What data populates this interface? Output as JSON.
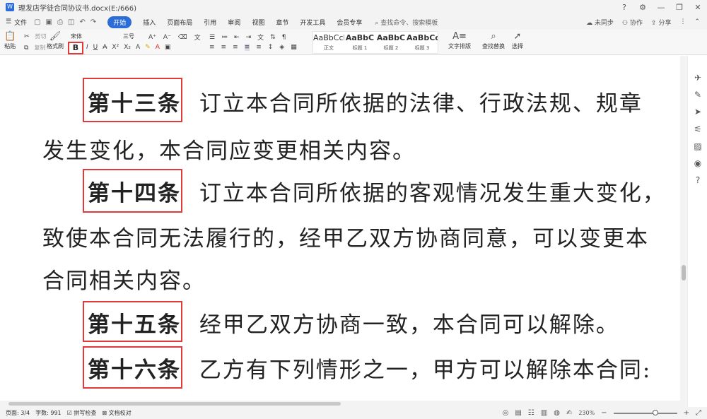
{
  "window": {
    "title": "理发店学徒合同协议书.docx(E:/666)",
    "controls": {
      "help": "?",
      "settings": "⚙",
      "minimize": "—",
      "restore": "❐",
      "close": "✕"
    }
  },
  "menubar": {
    "file_label": "文件",
    "tabs": [
      "开始",
      "插入",
      "页面布局",
      "引用",
      "审阅",
      "视图",
      "章节",
      "开发工具",
      "会员专享"
    ],
    "search_placeholder": "查找命令、搜索模板",
    "sync_label": "未同步",
    "collab_label": "协作",
    "share_label": "分享"
  },
  "ribbon": {
    "paste_label": "粘贴",
    "cut_label": "剪切",
    "copy_label": "复制",
    "format_painter_label": "格式刷",
    "font_name": "宋体",
    "font_size": "三号",
    "bold_label": "B",
    "styles": [
      {
        "sample": "AaBbCcDd",
        "name": "正文"
      },
      {
        "sample": "AaBbC",
        "name": "标题 1"
      },
      {
        "sample": "AaBbC",
        "name": "标题 2"
      },
      {
        "sample": "AaBbCc",
        "name": "标题 3"
      }
    ],
    "text_layout_label": "文字排版",
    "find_replace_label": "查找替换",
    "select_label": "选择"
  },
  "document": {
    "paragraphs": [
      {
        "article": "第十三条",
        "lines": [
          "订立本合同所依据的法律、行政法规、规章",
          "发生变化，本合同应变更相关内容。"
        ]
      },
      {
        "article": "第十四条",
        "lines": [
          "订立本合同所依据的客观情况发生重大变化，",
          "致使本合同无法履行的，经甲乙双方协商同意，可以变更本",
          "合同相关内容。"
        ]
      },
      {
        "article": "第十五条",
        "lines": [
          "经甲乙双方协商一致，本合同可以解除。"
        ]
      },
      {
        "article": "第十六条",
        "lines": [
          "乙方有下列情形之一，甲方可以解除本合同:"
        ]
      }
    ]
  },
  "statusbar": {
    "page": "页面: 3/4",
    "word_count": "字数: 991",
    "spell_check": "拼写检查",
    "doc_proofread": "文档校对",
    "zoom": "230%",
    "zoom_fraction": 0.66
  }
}
